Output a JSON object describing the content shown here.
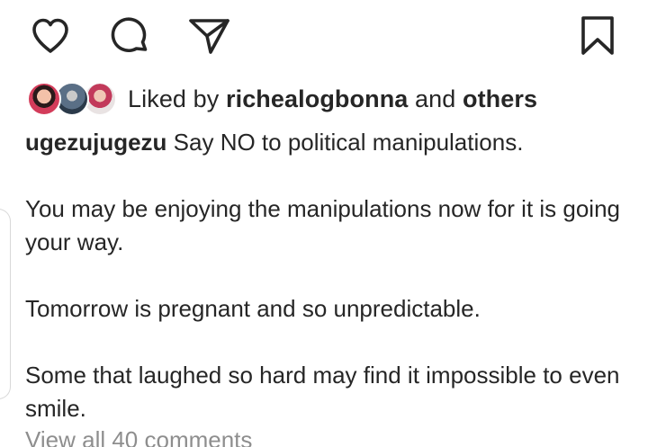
{
  "actions": {
    "like_icon": "heart-outline",
    "comment_icon": "speech-bubble-outline",
    "share_icon": "paper-plane-outline",
    "save_icon": "bookmark-outline"
  },
  "likes": {
    "prefix": "Liked by",
    "user": "richealogbonna",
    "conjunction": "and",
    "others": "others"
  },
  "caption": {
    "username": "ugezujugezu",
    "first_line": "Say NO to political manipulations.",
    "paragraphs": [
      "You may be enjoying the manipulations now for it is going your way.",
      "Tomorrow is pregnant and so unpredictable.",
      "Some that laughed so hard may find it impossible to even smile."
    ]
  },
  "comments": {
    "view_all_label": "View all 40 comments"
  },
  "colors": {
    "text": "#262626",
    "muted": "#8e8e8e",
    "background": "#ffffff"
  }
}
